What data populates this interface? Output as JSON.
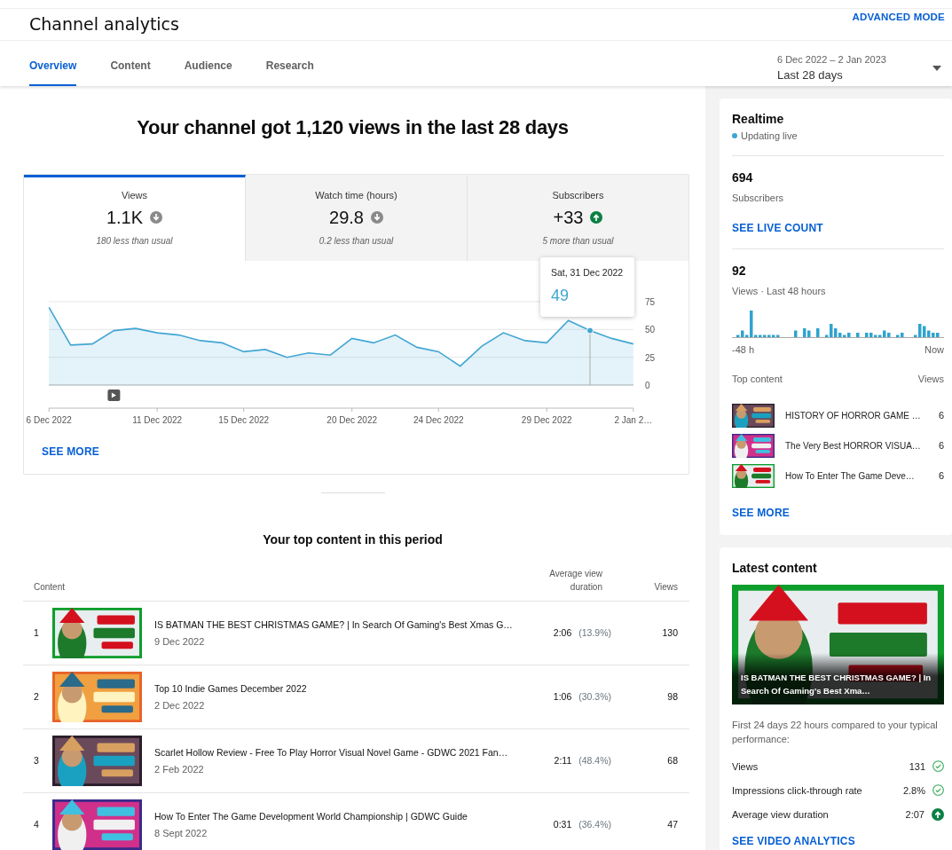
{
  "header": {
    "title": "Channel analytics",
    "advanced_mode": "ADVANCED MODE"
  },
  "tabs": [
    {
      "label": "Overview",
      "selected": true
    },
    {
      "label": "Content",
      "selected": false
    },
    {
      "label": "Audience",
      "selected": false
    },
    {
      "label": "Research",
      "selected": false
    }
  ],
  "date_range": {
    "range": "6 Dec 2022 – 2 Jan 2023",
    "period": "Last 28 days"
  },
  "headline": "Your channel got 1,120 views in the last 28 days",
  "metrics": [
    {
      "label": "Views",
      "value": "1.1K",
      "up": false,
      "note": "180 less than usual",
      "selected": true
    },
    {
      "label": "Watch time (hours)",
      "value": "29.8",
      "up": false,
      "note": "0.2 less than usual",
      "selected": false
    },
    {
      "label": "Subscribers",
      "value": "+33",
      "up": true,
      "note": "5 more than usual",
      "selected": false
    }
  ],
  "chart_data": {
    "type": "area",
    "categories": [
      "6 Dec 2022",
      null,
      null,
      null,
      null,
      "11 Dec 2022",
      null,
      null,
      null,
      "15 Dec 2022",
      null,
      null,
      null,
      null,
      "20 Dec 2022",
      null,
      null,
      null,
      "24 Dec 2022",
      null,
      null,
      null,
      null,
      "29 Dec 2022",
      null,
      null,
      null,
      "2 Jan 2…"
    ],
    "series": [
      {
        "color": "#41a6d3",
        "values": [
          70,
          36,
          37,
          49,
          51,
          47,
          45,
          40,
          38,
          30,
          32,
          25,
          29,
          27,
          42,
          38,
          45,
          34,
          30,
          17,
          35,
          47,
          40,
          38,
          58,
          49,
          42,
          37
        ]
      }
    ],
    "ylim": [
      0,
      75
    ],
    "yticks": [
      0,
      25,
      50,
      75
    ],
    "annotations": [
      {
        "y": 49,
        "text": "49"
      }
    ]
  },
  "tooltip_date": "Sat, 31 Dec 2022",
  "see_more": "SEE MORE",
  "top_content": {
    "title": "Your top content in this period",
    "columns": [
      "Content",
      "Average view duration",
      "Views"
    ],
    "rows": [
      {
        "rank": "1",
        "title": "IS BATMAN THE BEST CHRISTMAS GAME? | In Search Of Gaming's Best Xmas G…",
        "date": "9 Dec 2022",
        "duration": "2:06",
        "percent": "(13.9%)",
        "views": "130"
      },
      {
        "rank": "2",
        "title": "Top 10 Indie Games December 2022",
        "date": "2 Dec 2022",
        "duration": "1:06",
        "percent": "(30.3%)",
        "views": "98"
      },
      {
        "rank": "3",
        "title": "Scarlet Hollow Review - Free To Play Horror Visual Novel Game - GDWC 2021 Fan…",
        "date": "2 Feb 2022",
        "duration": "2:11",
        "percent": "(48.4%)",
        "views": "68"
      },
      {
        "rank": "4",
        "title": "How To Enter The Game Development World Championship | GDWC Guide",
        "date": "8 Sept 2022",
        "duration": "0:31",
        "percent": "(36.4%)",
        "views": "47"
      }
    ]
  },
  "realtime": {
    "title": "Realtime",
    "status": "Updating live",
    "subscribers": "694",
    "subscribers_label": "Subscribers",
    "live_count_link": "SEE LIVE COUNT",
    "views": "92",
    "views_label": "Views · Last 48 hours",
    "axis_start": "-48 h",
    "axis_end": "Now",
    "top_content_label": "Top content",
    "views_column": "Views",
    "items": [
      {
        "title": "HISTORY OF HORROR GAME …",
        "views": "6"
      },
      {
        "title": "The Very Best HORROR VISUA…",
        "views": "6"
      },
      {
        "title": "How To Enter The Game Deve…",
        "views": "6"
      }
    ],
    "see_more": "SEE MORE"
  },
  "latest_content": {
    "title": "Latest content",
    "video_title": "IS BATMAN THE BEST CHRISTMAS GAME? | In Search Of Gaming's Best Xma…",
    "comparison": "First 24 days 22 hours compared to your typical performance:",
    "metrics": [
      {
        "label": "Views",
        "value": "131",
        "above_typical": false
      },
      {
        "label": "Impressions click-through rate",
        "value": "2.8%",
        "above_typical": false
      },
      {
        "label": "Average view duration",
        "value": "2:07",
        "above_typical": true
      }
    ],
    "link": "SEE VIDEO ANALYTICS"
  }
}
